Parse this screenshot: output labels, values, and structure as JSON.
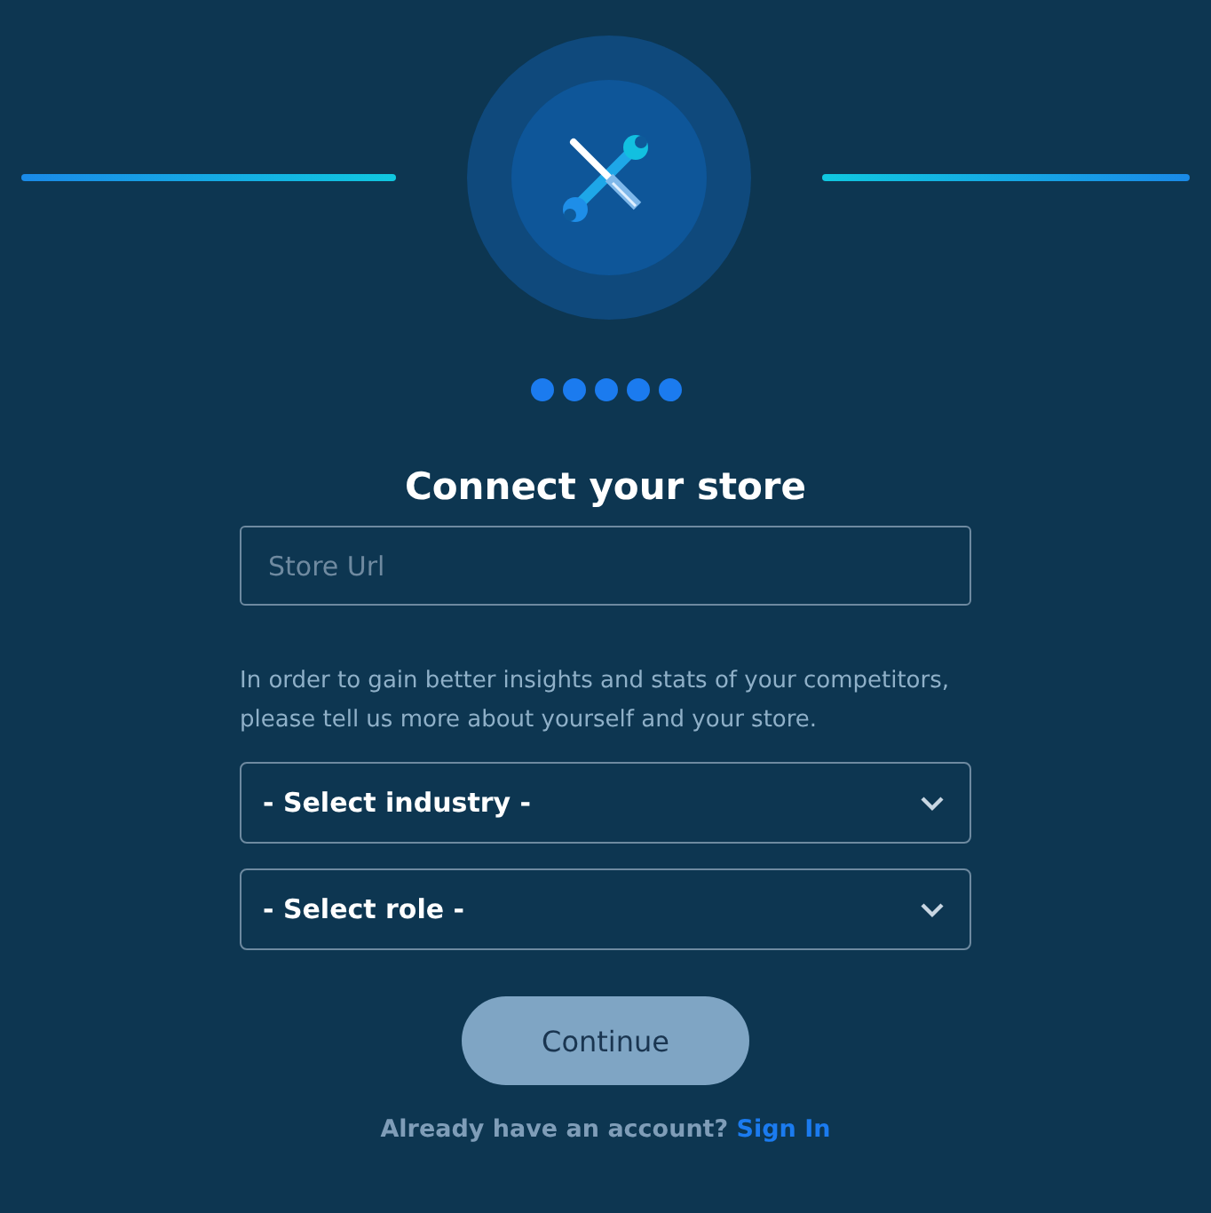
{
  "title": "Connect your store",
  "store_url": {
    "placeholder": "Store Url"
  },
  "description": "In order to gain better insights and stats of your competitors, please tell us more about yourself and your store.",
  "selects": [
    {
      "value": "- Select industry -"
    },
    {
      "value": "- Select role -"
    }
  ],
  "continue_button": {
    "label": "Continue",
    "disabled": true
  },
  "footer": {
    "text": "Already have an account?",
    "link": "Sign In"
  }
}
